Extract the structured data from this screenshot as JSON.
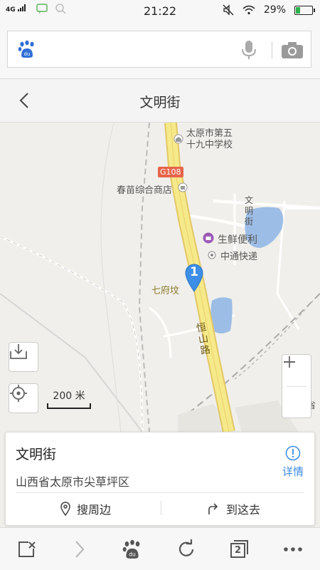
{
  "status": {
    "network": "4G",
    "time": "21:22",
    "battery": "29%",
    "battery_level": 0.29
  },
  "search": {
    "placeholder": ""
  },
  "header": {
    "title": "文明街"
  },
  "map": {
    "labels": {
      "school": "太原市第五十九中学校",
      "school_line1": "太原市第五",
      "school_line2": "十九中学校",
      "highway": "G108",
      "shop": "春苗综合商店",
      "street_v": "文明街",
      "fresh": "生鲜便利",
      "express": "中通快递",
      "village": "七府坟",
      "road": "恒山路",
      "right_edge": "山西省"
    },
    "marker_number": "1",
    "scale_label": "200 米"
  },
  "card": {
    "name": "文明街",
    "address": "山西省太原市尖草坪区",
    "detail_label": "详情",
    "nearby_label": "搜周边",
    "navigate_label": "到这去"
  },
  "bottom": {
    "tab_count": "2"
  },
  "colors": {
    "accent": "#3b8be0",
    "road": "#f6e98a",
    "water": "#9cbde6"
  }
}
